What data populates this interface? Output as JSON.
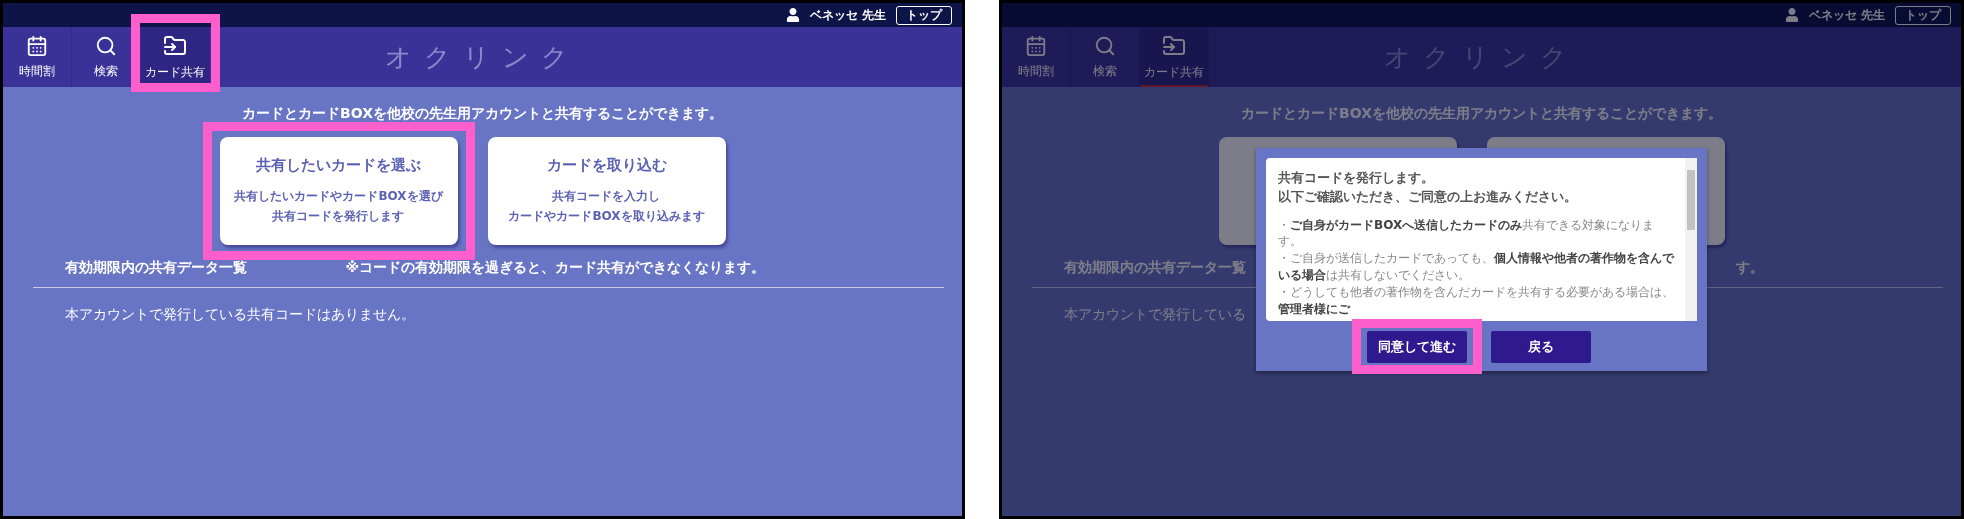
{
  "screens": [
    {
      "top_bar": {
        "user": "ベネッセ 先生",
        "top_button": "トップ"
      },
      "nav": [
        {
          "label": "時間割",
          "selected": false,
          "highlighted": false
        },
        {
          "label": "検索",
          "selected": false,
          "highlighted": false
        },
        {
          "label": "カード共有",
          "selected": true,
          "highlighted": true
        }
      ],
      "app_title": "オクリンク",
      "intro": "カードとカードBOXを他校の先生用アカウントと共有することができます。",
      "cards": [
        {
          "title": "共有したいカードを選ぶ",
          "lines": [
            "共有したいカードやカードBOXを選び",
            "共有コードを発行します"
          ],
          "highlighted": true
        },
        {
          "title": "カードを取り込む",
          "lines": [
            "共有コードを入力し",
            "カードやカードBOXを取り込みます"
          ],
          "highlighted": false
        }
      ],
      "list_title": "有効期限内の共有データ一覧",
      "list_note": "※コードの有効期限を過ぎると、カード共有ができなくなります。",
      "empty_text": "本アカウントで発行している共有コードはありません。"
    },
    {
      "top_bar": {
        "user": "ベネッセ 先生",
        "top_button": "トップ"
      },
      "nav": [
        {
          "label": "時間割",
          "selected": false,
          "highlighted": false
        },
        {
          "label": "検索",
          "selected": false,
          "highlighted": false
        },
        {
          "label": "カード共有",
          "selected": true,
          "highlighted": false
        }
      ],
      "app_title": "オクリンク",
      "intro": "カードとカードBOXを他校の先生用アカウントと共有することができます。",
      "cards": [
        {
          "highlighted": false
        },
        {
          "highlighted": false
        }
      ],
      "list_title": "有効期限内の共有データ一覧",
      "list_note": "す。",
      "empty_text": "本アカウントで発行している",
      "modal": {
        "heading": [
          "共有コードを発行します。",
          "以下ご確認いただき、ご同意の上お進みください。"
        ],
        "bullets": [
          "・**ご自身がカードBOXへ送信したカードのみ**共有できる対象になります。",
          "・ご自身が送信したカードであっても、**個人情報や他者の著作物を含んでいる場合**は共有しないでください。",
          "・どうしても他者の著作物を含んだカードを共有する必要がある場合は、**管理者様にご**"
        ],
        "buttons": [
          {
            "label": "同意して進む",
            "highlighted": true
          },
          {
            "label": "戻る",
            "highlighted": false
          }
        ]
      }
    }
  ]
}
